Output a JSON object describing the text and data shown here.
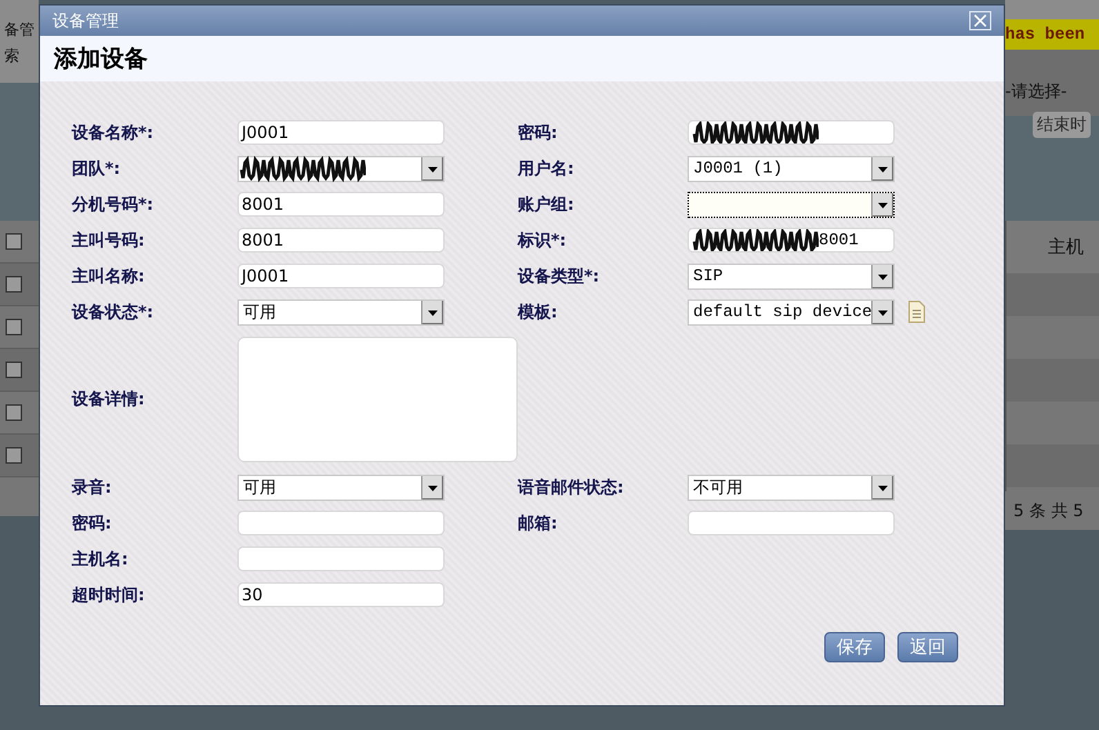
{
  "background_page": {
    "left_texts": [
      "备管",
      "索"
    ],
    "row_checkboxes": [
      {
        "checked": false
      },
      {
        "checked": false
      },
      {
        "checked": false
      },
      {
        "checked": false
      },
      {
        "checked": false
      },
      {
        "checked": false
      }
    ],
    "notice": "has been",
    "filter_select": "-请选择-",
    "end_time_placeholder": "结束时",
    "column_header": "主机",
    "pager": "5 条 共 5"
  },
  "dialog": {
    "title": "设备管理",
    "heading": "添加设备",
    "rows": [
      {
        "left": {
          "label": "设备名称*:",
          "kind": "text",
          "value": "J0001"
        },
        "right": {
          "label": "密码:",
          "kind": "text",
          "redacted": true
        }
      },
      {
        "left": {
          "label": "团队*:",
          "kind": "select",
          "redacted": true
        },
        "right": {
          "label": "用户名:",
          "kind": "select",
          "value": "J0001 (1)"
        }
      },
      {
        "left": {
          "label": "分机号码*:",
          "kind": "text",
          "value": "8001"
        },
        "right": {
          "label": "账户组:",
          "kind": "select",
          "focused": true
        }
      },
      {
        "left": {
          "label": "主叫号码:",
          "kind": "text",
          "value": "8001"
        },
        "right": {
          "label": "标识*:",
          "kind": "text",
          "redacted": true,
          "value": "8001"
        }
      },
      {
        "left": {
          "label": "主叫名称:",
          "kind": "text",
          "value": "J0001"
        },
        "right": {
          "label": "设备类型*:",
          "kind": "select",
          "value": "SIP"
        }
      },
      {
        "left": {
          "label": "设备状态*:",
          "kind": "select",
          "value": "可用"
        },
        "right": {
          "label": "模板:",
          "kind": "select",
          "value": "default sip device",
          "icon_button": true
        }
      },
      {
        "left": {
          "label": "设备详情:",
          "kind": "textarea"
        }
      },
      {
        "left": {
          "label": "录音:",
          "kind": "select",
          "value": "可用"
        },
        "right": {
          "label": "语音邮件状态:",
          "kind": "select",
          "value": "不可用"
        }
      },
      {
        "left": {
          "label": "密码:",
          "kind": "text"
        },
        "right": {
          "label": "邮箱:",
          "kind": "text"
        }
      },
      {
        "left": {
          "label": "主机名:",
          "kind": "text"
        }
      },
      {
        "left": {
          "label": "超时时间:",
          "kind": "text",
          "value": "30"
        }
      }
    ],
    "buttons": [
      "保存",
      "返回"
    ]
  }
}
